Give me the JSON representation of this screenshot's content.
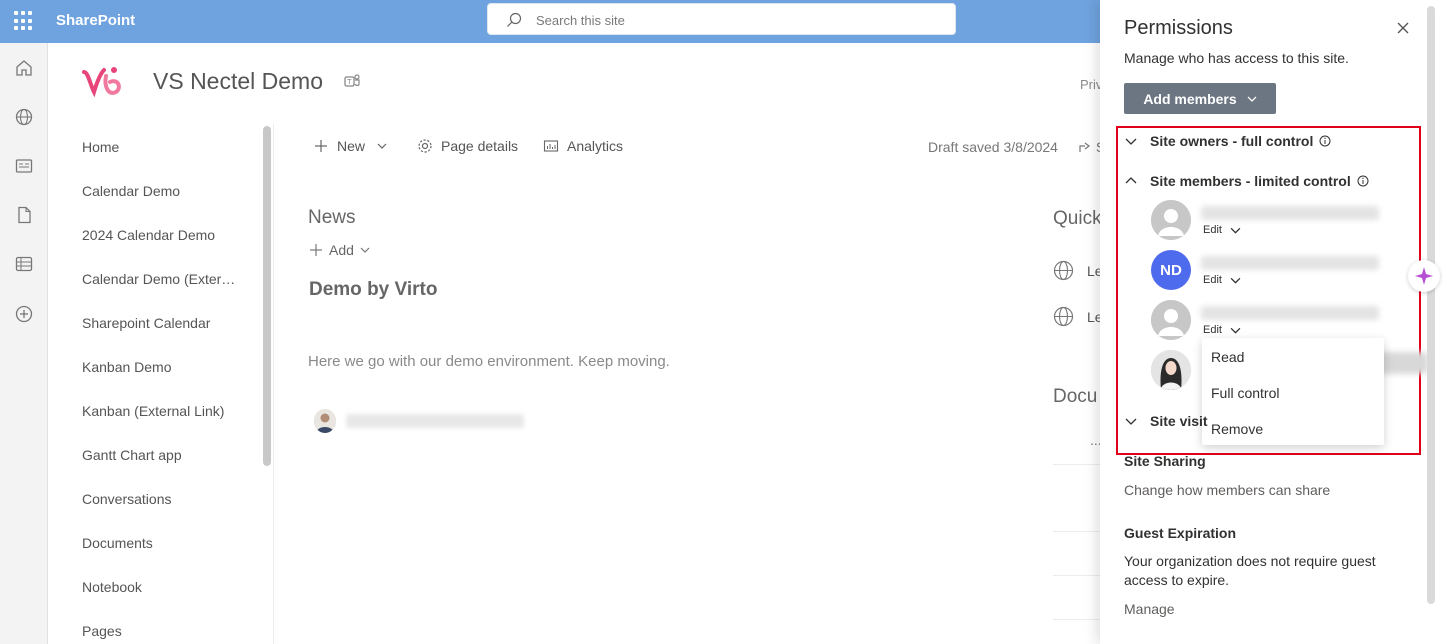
{
  "suite": {
    "app_name": "SharePoint",
    "search_placeholder": "Search this site"
  },
  "rail": {
    "icons": [
      "home-icon",
      "globe-icon",
      "news-icon",
      "file-icon",
      "list-icon",
      "add-icon"
    ]
  },
  "site": {
    "title": "VS Nectel Demo",
    "privacy_fragment": "Priv"
  },
  "nav": {
    "items": [
      "Home",
      "Calendar Demo",
      "2024 Calendar Demo",
      "Calendar Demo (Extern...",
      "Sharepoint Calendar",
      "Kanban Demo",
      "Kanban (External Link)",
      "Gantt Chart app",
      "Conversations",
      "Documents",
      "Notebook",
      "Pages"
    ]
  },
  "commandbar": {
    "new_label": "New",
    "page_details_label": "Page details",
    "analytics_label": "Analytics",
    "draft_status": "Draft saved 3/8/2024",
    "share_fragment": "S"
  },
  "content": {
    "news_title": "News",
    "add_label": "Add",
    "post_title": "Demo by Virto",
    "post_body": "Here we go with our demo environment. Keep moving.",
    "quick_title": "Quick",
    "quick_links": [
      "Le",
      "Le"
    ],
    "docs_title": "Docu",
    "docs_more": "..."
  },
  "permissions": {
    "title": "Permissions",
    "subtitle": "Manage who has access to this site.",
    "add_members_label": "Add members",
    "groups": {
      "owners": "Site owners - full control",
      "members": "Site members - limited control",
      "visitors": "Site visit"
    },
    "members": [
      {
        "initials": "",
        "role": "Edit"
      },
      {
        "initials": "ND",
        "role": "Edit"
      },
      {
        "initials": "",
        "role": "Edit"
      },
      {
        "initials": "",
        "role": ""
      }
    ],
    "role_menu": [
      "Read",
      "Full control",
      "Remove"
    ],
    "site_sharing": {
      "title": "Site Sharing",
      "link": "Change how members can share"
    },
    "guest_expiration": {
      "title": "Guest Expiration",
      "text": "Your organization does not require guest access to expire.",
      "link": "Manage"
    }
  }
}
